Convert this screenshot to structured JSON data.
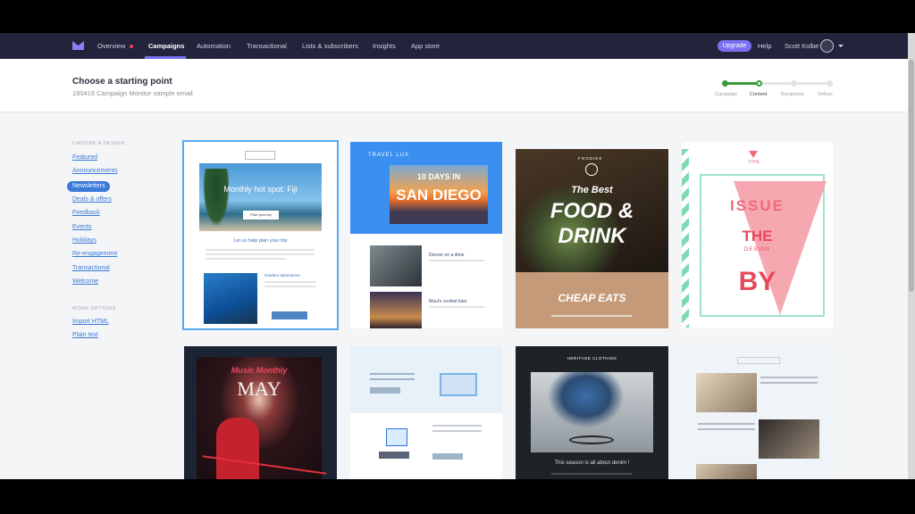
{
  "nav": {
    "links": [
      "Overview",
      "Campaigns",
      "Automation",
      "Transactional",
      "Lists & subscribers",
      "Insights",
      "App store"
    ],
    "upgrade": "Upgrade",
    "help": "Help",
    "user": "Scott Kolbe"
  },
  "header": {
    "title": "Choose a starting point",
    "subtitle": "190416 Campaign Monitor sample email",
    "steps": [
      "Campaign",
      "Content",
      "Recipients",
      "Deliver"
    ],
    "current_step": "Content"
  },
  "sidebar": {
    "design_heading": "CHOOSE A DESIGN",
    "items": [
      "Featured",
      "Announcements",
      "Newsletters",
      "Deals & offers",
      "Feedback",
      "Events",
      "Holidays",
      "Re-engagement",
      "Transactional",
      "Welcome"
    ],
    "selected": "Newsletters",
    "more_heading": "MORE OPTIONS",
    "more_items": [
      "Import HTML",
      "Plain text"
    ]
  },
  "templates": {
    "fiji": {
      "heading": "Monthly hot spot: Fiji",
      "cta": "Plan your trip",
      "section": "Let us help plan your trip",
      "side": "Outdoor adventures"
    },
    "travel": {
      "brand": "TRAVEL LUX",
      "line1": "10 DAYS IN",
      "line2": "SAN DIEGO",
      "item1": "Denver on a dime",
      "item2": "Maui's coolest bars"
    },
    "food": {
      "brand": "FOODIES",
      "line1": "The Best",
      "line2": "FOOD &",
      "line3": "DRINK",
      "footer": "CHEAP EATS"
    },
    "issue": {
      "brand": "TYPE",
      "line1": "ISSUE",
      "line2": "THE",
      "line3": "DESIGN",
      "line4": "BY"
    },
    "music": {
      "script": "Music Monthly",
      "month": "MAY"
    },
    "heritage": {
      "brand": "HERITAGE CLOTHING",
      "caption": "This season is all about denim !"
    }
  },
  "colors": {
    "nav_bg": "#23233b",
    "accent": "#7a6ff0",
    "link": "#3b7ad9",
    "progress": "#3a9d3a",
    "selected_outline": "#59a8f0"
  }
}
